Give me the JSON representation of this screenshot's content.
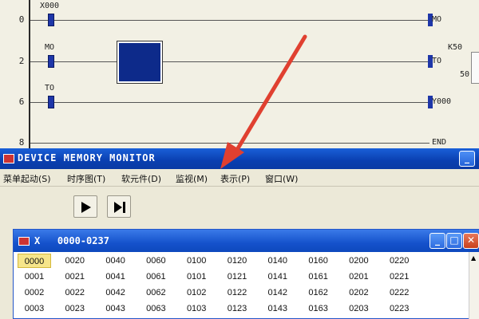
{
  "ladder": {
    "rungs": [
      {
        "number": "0",
        "contact": "X000",
        "coil": "MO"
      },
      {
        "number": "2",
        "contact": "MO",
        "coil": "TO"
      },
      {
        "number": "6",
        "contact": "TO",
        "coil": "Y000"
      },
      {
        "number": "8",
        "coil": "END"
      }
    ],
    "timer_setting": "K50",
    "timer_value": "50"
  },
  "monitor_window": {
    "title": "DEVICE MEMORY MONITOR",
    "minimize_glyph": "_",
    "menu": [
      "菜单起动(S)",
      "时序图(T)",
      "软元件(D)",
      "监视(M)",
      "表示(P)",
      "窗口(W)"
    ],
    "toolbar": {
      "play_icon": "play-icon",
      "step_icon": "step-icon"
    }
  },
  "device_window": {
    "title": "X   0000-0237",
    "selected_address": "0000",
    "columns": [
      [
        "0000",
        "0001",
        "0002",
        "0003"
      ],
      [
        "0020",
        "0021",
        "0022",
        "0023"
      ],
      [
        "0040",
        "0041",
        "0042",
        "0043"
      ],
      [
        "0060",
        "0061",
        "0062",
        "0063"
      ],
      [
        "0100",
        "0101",
        "0102",
        "0103"
      ],
      [
        "0120",
        "0121",
        "0122",
        "0123"
      ],
      [
        "0140",
        "0141",
        "0142",
        "0143"
      ],
      [
        "0160",
        "0161",
        "0162",
        "0163"
      ],
      [
        "0200",
        "0201",
        "0202",
        "0203"
      ],
      [
        "0220",
        "0221",
        "0222",
        "0223"
      ]
    ],
    "minimize_glyph": "_",
    "maximize_glyph": "□",
    "close_glyph": "✕"
  },
  "colors": {
    "titlebar": "#0a3fb0",
    "selection": "#f6e58a",
    "annotation_arrow": "#e04030"
  }
}
